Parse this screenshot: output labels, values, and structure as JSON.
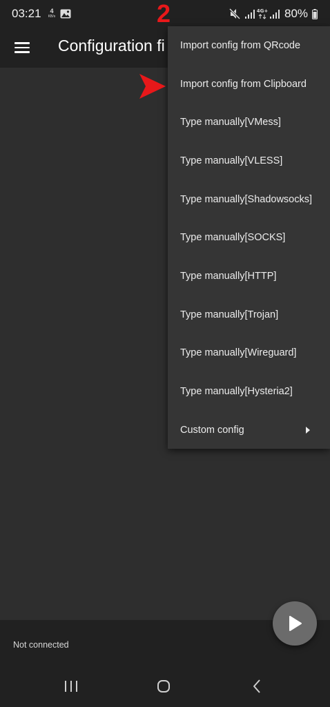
{
  "status_bar": {
    "time": "03:21",
    "net_speed_value": "4",
    "net_speed_unit": "KB/s",
    "network_label": "4G+",
    "battery": "80%"
  },
  "app_bar": {
    "title": "Configuration fi"
  },
  "annotation": {
    "number": "2",
    "color": "#e8181a"
  },
  "dropdown": {
    "items": [
      {
        "label": "Import config from QRcode"
      },
      {
        "label": "Import config from Clipboard"
      },
      {
        "label": "Type manually[VMess]"
      },
      {
        "label": "Type manually[VLESS]"
      },
      {
        "label": "Type manually[Shadowsocks]"
      },
      {
        "label": "Type manually[SOCKS]"
      },
      {
        "label": "Type manually[HTTP]"
      },
      {
        "label": "Type manually[Trojan]"
      },
      {
        "label": "Type manually[Wireguard]"
      },
      {
        "label": "Type manually[Hysteria2]"
      },
      {
        "label": "Custom config"
      }
    ]
  },
  "footer": {
    "status": "Not connected"
  },
  "colors": {
    "background": "#2e2e2e",
    "bar": "#212121",
    "menu": "#353535",
    "fab": "#6b6b6b"
  },
  "icons": {
    "menu": "hamburger-menu-icon",
    "fab": "play-icon",
    "submenu": "chevron-right-icon",
    "nav_recent": "recent-apps-icon",
    "nav_home": "home-icon",
    "nav_back": "back-icon"
  }
}
